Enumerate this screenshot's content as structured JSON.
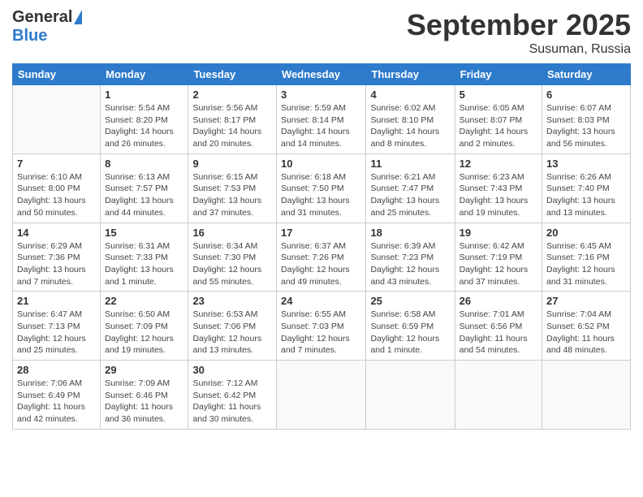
{
  "header": {
    "logo_general": "General",
    "logo_blue": "Blue",
    "month": "September 2025",
    "location": "Susuman, Russia"
  },
  "days_of_week": [
    "Sunday",
    "Monday",
    "Tuesday",
    "Wednesday",
    "Thursday",
    "Friday",
    "Saturday"
  ],
  "weeks": [
    [
      {
        "day": "",
        "info": ""
      },
      {
        "day": "1",
        "info": "Sunrise: 5:54 AM\nSunset: 8:20 PM\nDaylight: 14 hours\nand 26 minutes."
      },
      {
        "day": "2",
        "info": "Sunrise: 5:56 AM\nSunset: 8:17 PM\nDaylight: 14 hours\nand 20 minutes."
      },
      {
        "day": "3",
        "info": "Sunrise: 5:59 AM\nSunset: 8:14 PM\nDaylight: 14 hours\nand 14 minutes."
      },
      {
        "day": "4",
        "info": "Sunrise: 6:02 AM\nSunset: 8:10 PM\nDaylight: 14 hours\nand 8 minutes."
      },
      {
        "day": "5",
        "info": "Sunrise: 6:05 AM\nSunset: 8:07 PM\nDaylight: 14 hours\nand 2 minutes."
      },
      {
        "day": "6",
        "info": "Sunrise: 6:07 AM\nSunset: 8:03 PM\nDaylight: 13 hours\nand 56 minutes."
      }
    ],
    [
      {
        "day": "7",
        "info": "Sunrise: 6:10 AM\nSunset: 8:00 PM\nDaylight: 13 hours\nand 50 minutes."
      },
      {
        "day": "8",
        "info": "Sunrise: 6:13 AM\nSunset: 7:57 PM\nDaylight: 13 hours\nand 44 minutes."
      },
      {
        "day": "9",
        "info": "Sunrise: 6:15 AM\nSunset: 7:53 PM\nDaylight: 13 hours\nand 37 minutes."
      },
      {
        "day": "10",
        "info": "Sunrise: 6:18 AM\nSunset: 7:50 PM\nDaylight: 13 hours\nand 31 minutes."
      },
      {
        "day": "11",
        "info": "Sunrise: 6:21 AM\nSunset: 7:47 PM\nDaylight: 13 hours\nand 25 minutes."
      },
      {
        "day": "12",
        "info": "Sunrise: 6:23 AM\nSunset: 7:43 PM\nDaylight: 13 hours\nand 19 minutes."
      },
      {
        "day": "13",
        "info": "Sunrise: 6:26 AM\nSunset: 7:40 PM\nDaylight: 13 hours\nand 13 minutes."
      }
    ],
    [
      {
        "day": "14",
        "info": "Sunrise: 6:29 AM\nSunset: 7:36 PM\nDaylight: 13 hours\nand 7 minutes."
      },
      {
        "day": "15",
        "info": "Sunrise: 6:31 AM\nSunset: 7:33 PM\nDaylight: 13 hours\nand 1 minute."
      },
      {
        "day": "16",
        "info": "Sunrise: 6:34 AM\nSunset: 7:30 PM\nDaylight: 12 hours\nand 55 minutes."
      },
      {
        "day": "17",
        "info": "Sunrise: 6:37 AM\nSunset: 7:26 PM\nDaylight: 12 hours\nand 49 minutes."
      },
      {
        "day": "18",
        "info": "Sunrise: 6:39 AM\nSunset: 7:23 PM\nDaylight: 12 hours\nand 43 minutes."
      },
      {
        "day": "19",
        "info": "Sunrise: 6:42 AM\nSunset: 7:19 PM\nDaylight: 12 hours\nand 37 minutes."
      },
      {
        "day": "20",
        "info": "Sunrise: 6:45 AM\nSunset: 7:16 PM\nDaylight: 12 hours\nand 31 minutes."
      }
    ],
    [
      {
        "day": "21",
        "info": "Sunrise: 6:47 AM\nSunset: 7:13 PM\nDaylight: 12 hours\nand 25 minutes."
      },
      {
        "day": "22",
        "info": "Sunrise: 6:50 AM\nSunset: 7:09 PM\nDaylight: 12 hours\nand 19 minutes."
      },
      {
        "day": "23",
        "info": "Sunrise: 6:53 AM\nSunset: 7:06 PM\nDaylight: 12 hours\nand 13 minutes."
      },
      {
        "day": "24",
        "info": "Sunrise: 6:55 AM\nSunset: 7:03 PM\nDaylight: 12 hours\nand 7 minutes."
      },
      {
        "day": "25",
        "info": "Sunrise: 6:58 AM\nSunset: 6:59 PM\nDaylight: 12 hours\nand 1 minute."
      },
      {
        "day": "26",
        "info": "Sunrise: 7:01 AM\nSunset: 6:56 PM\nDaylight: 11 hours\nand 54 minutes."
      },
      {
        "day": "27",
        "info": "Sunrise: 7:04 AM\nSunset: 6:52 PM\nDaylight: 11 hours\nand 48 minutes."
      }
    ],
    [
      {
        "day": "28",
        "info": "Sunrise: 7:06 AM\nSunset: 6:49 PM\nDaylight: 11 hours\nand 42 minutes."
      },
      {
        "day": "29",
        "info": "Sunrise: 7:09 AM\nSunset: 6:46 PM\nDaylight: 11 hours\nand 36 minutes."
      },
      {
        "day": "30",
        "info": "Sunrise: 7:12 AM\nSunset: 6:42 PM\nDaylight: 11 hours\nand 30 minutes."
      },
      {
        "day": "",
        "info": ""
      },
      {
        "day": "",
        "info": ""
      },
      {
        "day": "",
        "info": ""
      },
      {
        "day": "",
        "info": ""
      }
    ]
  ]
}
